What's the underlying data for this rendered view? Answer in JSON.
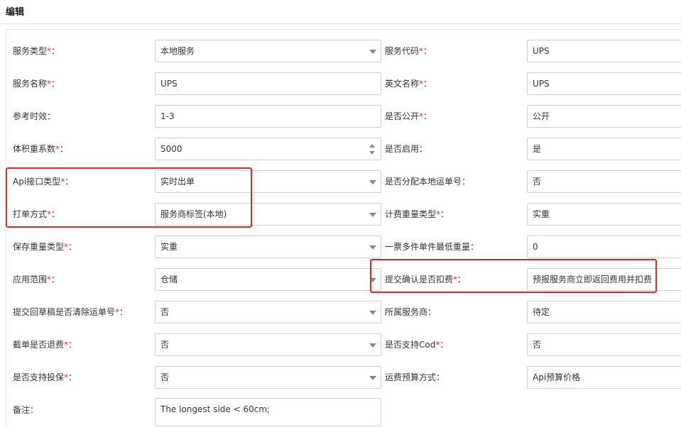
{
  "header": {
    "title": "编辑"
  },
  "rows": [
    {
      "left_label": "服务类型",
      "left_req": "*",
      "left_value": "本地服务",
      "right_label": "服务代码",
      "right_req": "*",
      "right_value": "UPS"
    },
    {
      "left_label": "服务名称",
      "left_req": "*",
      "left_value": "UPS",
      "right_label": "英文名称",
      "right_req": "*",
      "right_value": "UPS"
    },
    {
      "left_label": "参考时效",
      "left_req": "",
      "left_value": "1-3",
      "right_label": "是否公开",
      "right_req": "*",
      "right_value": "公开"
    },
    {
      "left_label": "体积重系数",
      "left_req": "*",
      "left_value": "5000",
      "right_label": "是否启用",
      "right_req": "",
      "right_value": "是"
    },
    {
      "left_label": "Api接口类型",
      "left_req": "*",
      "left_value": "实时出单",
      "right_label": "是否分配本地运单号",
      "right_req": "",
      "right_value": "否"
    },
    {
      "left_label": "打单方式",
      "left_req": "*",
      "left_value": "服务商标签(本地)",
      "right_label": "计费重量类型",
      "right_req": "*",
      "right_value": "实重"
    },
    {
      "left_label": "保存重量类型",
      "left_req": "*",
      "left_value": "实重",
      "right_label": "一票多件单件最低重量",
      "right_req": "",
      "right_value": "0"
    },
    {
      "left_label": "应用范围",
      "left_req": "*",
      "left_value": "仓储",
      "right_label": "提交确认是否扣费",
      "right_req": "*",
      "right_value": "预报服务商立即返回费用并扣费"
    },
    {
      "left_label": "提交回草稿是否清除运单号",
      "left_req": "*",
      "left_value": "否",
      "right_label": "所属服务商",
      "right_req": "",
      "right_value": "待定"
    },
    {
      "left_label": "截单是否退费",
      "left_req": "*",
      "left_value": "否",
      "right_label": "是否支持Cod",
      "right_req": "*",
      "right_value": "否"
    },
    {
      "left_label": "是否支持投保",
      "left_req": "*",
      "left_value": "否",
      "right_label": "运费预算方式",
      "right_req": "",
      "right_value": "Api预算价格"
    },
    {
      "left_label": "备注",
      "left_req": "",
      "left_value": "The longest side < 60cm;",
      "right_label": "",
      "right_req": "",
      "right_value": ""
    }
  ],
  "colon": "：",
  "highlight_color": "#e5262c"
}
